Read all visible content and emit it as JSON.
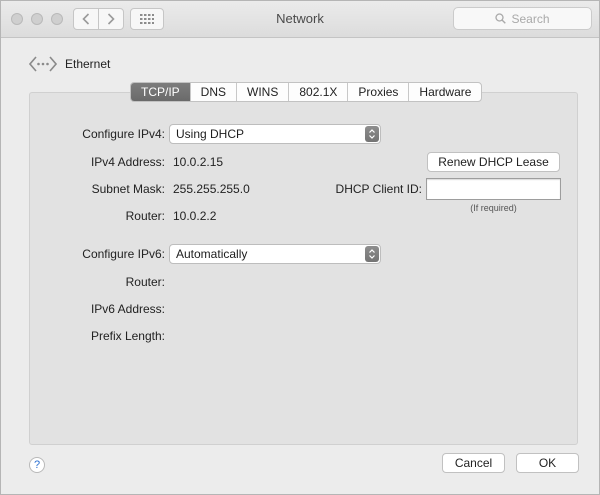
{
  "window": {
    "title": "Network",
    "search_placeholder": "Search"
  },
  "breadcrumb": {
    "label": "Ethernet"
  },
  "tabs": [
    {
      "label": "TCP/IP",
      "active": true
    },
    {
      "label": "DNS",
      "active": false
    },
    {
      "label": "WINS",
      "active": false
    },
    {
      "label": "802.1X",
      "active": false
    },
    {
      "label": "Proxies",
      "active": false
    },
    {
      "label": "Hardware",
      "active": false
    }
  ],
  "ipv4": {
    "configure_label": "Configure IPv4:",
    "configure_value": "Using DHCP",
    "address_label": "IPv4 Address:",
    "address_value": "10.0.2.15",
    "subnet_label": "Subnet Mask:",
    "subnet_value": "255.255.255.0",
    "router_label": "Router:",
    "router_value": "10.0.2.2"
  },
  "dhcp": {
    "renew_label": "Renew DHCP Lease",
    "client_id_label": "DHCP Client ID:",
    "client_id_value": "",
    "hint": "(If required)"
  },
  "ipv6": {
    "configure_label": "Configure IPv6:",
    "configure_value": "Automatically",
    "router_label": "Router:",
    "address_label": "IPv6 Address:",
    "prefix_label": "Prefix Length:"
  },
  "footer": {
    "help": "?",
    "cancel_label": "Cancel",
    "ok_label": "OK"
  }
}
